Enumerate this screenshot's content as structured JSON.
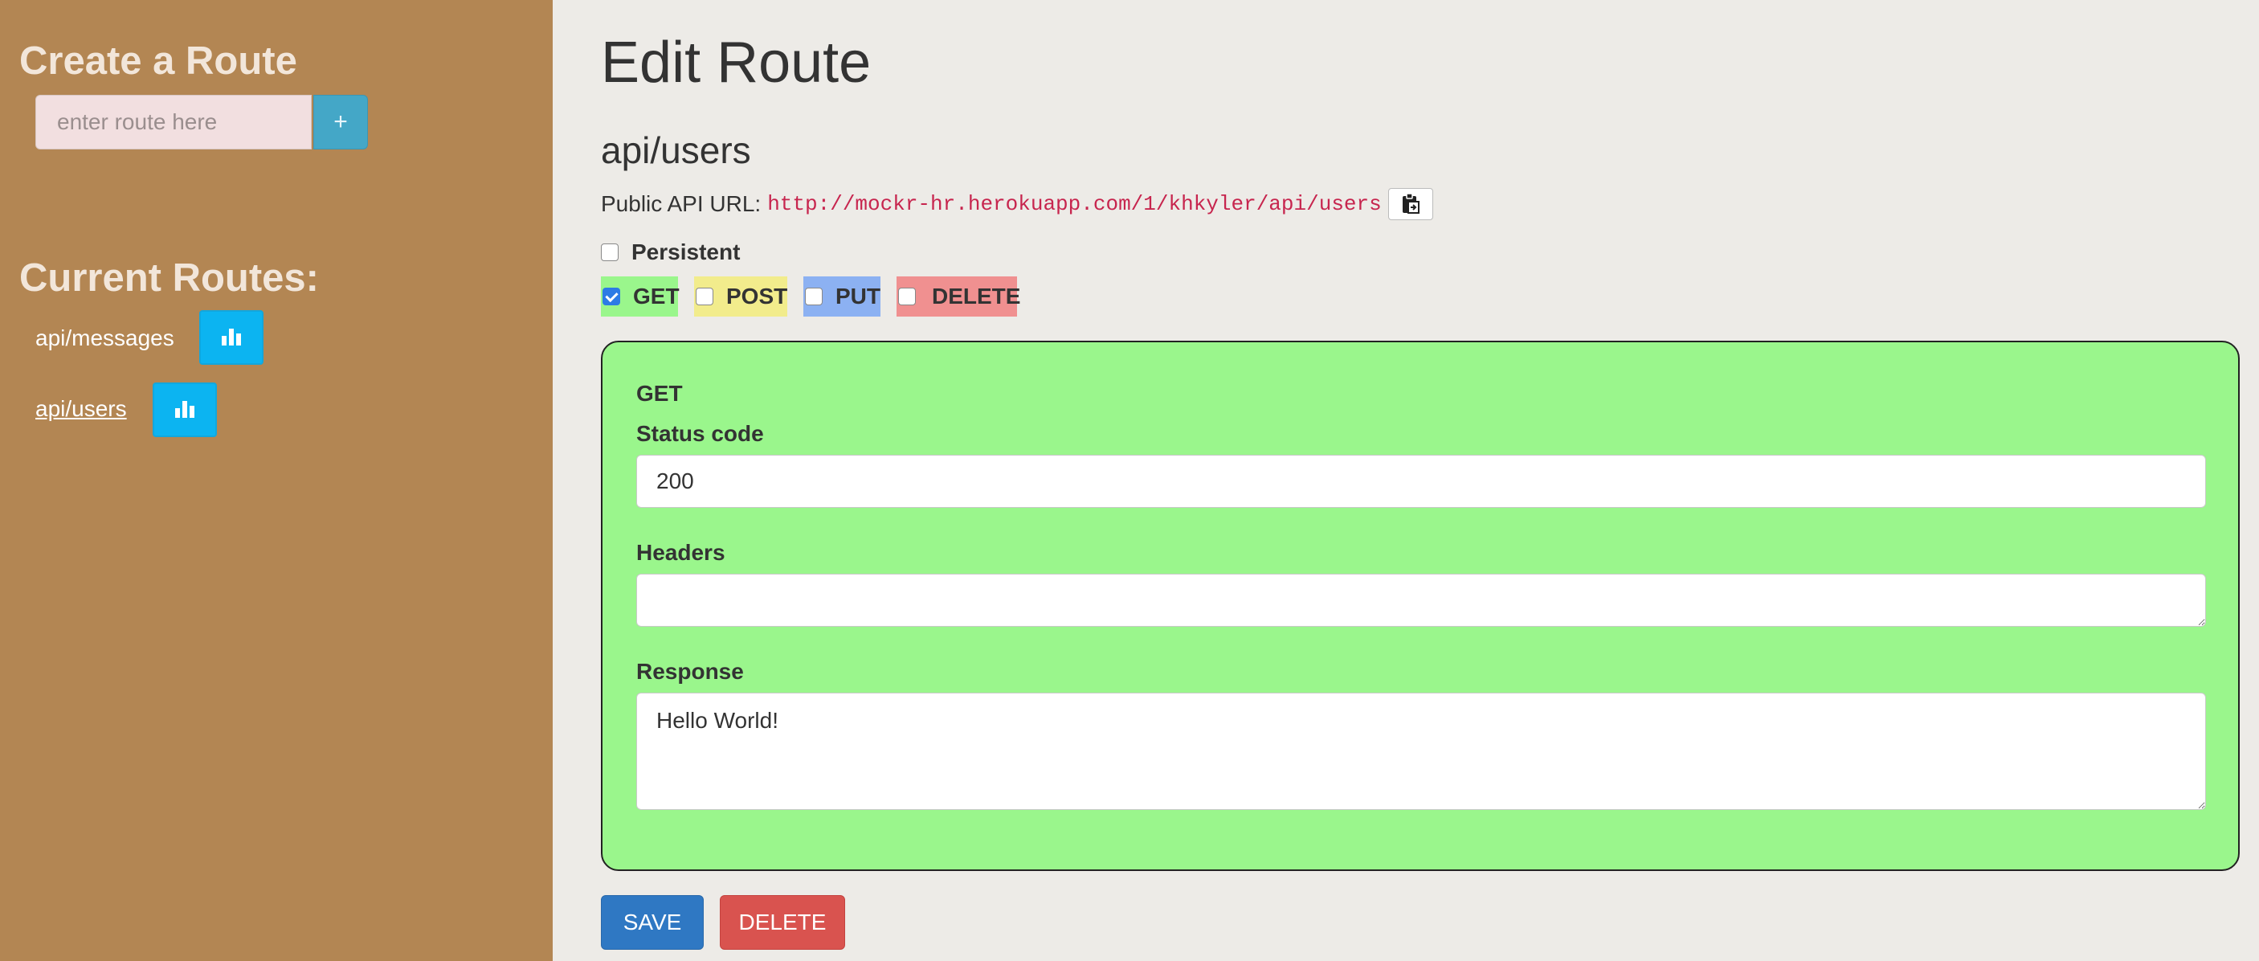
{
  "sidebar": {
    "create_title": "Create a Route",
    "route_input_placeholder": "enter route here",
    "add_button_label": "+",
    "current_title": "Current Routes:",
    "routes": [
      {
        "label": "api/messages",
        "active": false
      },
      {
        "label": "api/users",
        "active": true
      }
    ]
  },
  "main": {
    "title": "Edit Route",
    "route_name": "api/users",
    "public_api_label": "Public API URL:",
    "public_api_url": "http://mockr-hr.herokuapp.com/1/khkyler/api/users",
    "persistent_label": "Persistent",
    "persistent_checked": false,
    "methods": [
      {
        "label": "GET",
        "checked": true,
        "color": "#9af68c"
      },
      {
        "label": "POST",
        "checked": false,
        "color": "#f2ec8c"
      },
      {
        "label": "PUT",
        "checked": false,
        "color": "#8cb1f2"
      },
      {
        "label": "DELETE",
        "checked": false,
        "color": "#f09090"
      }
    ],
    "panel": {
      "method": "GET",
      "status_code_label": "Status code",
      "status_code_value": "200",
      "headers_label": "Headers",
      "headers_value": "",
      "response_label": "Response",
      "response_value": "Hello World!"
    },
    "save_label": "SAVE",
    "delete_label": "DELETE"
  },
  "icons": {
    "stats": "bar-chart-icon",
    "copy": "clipboard-icon"
  }
}
